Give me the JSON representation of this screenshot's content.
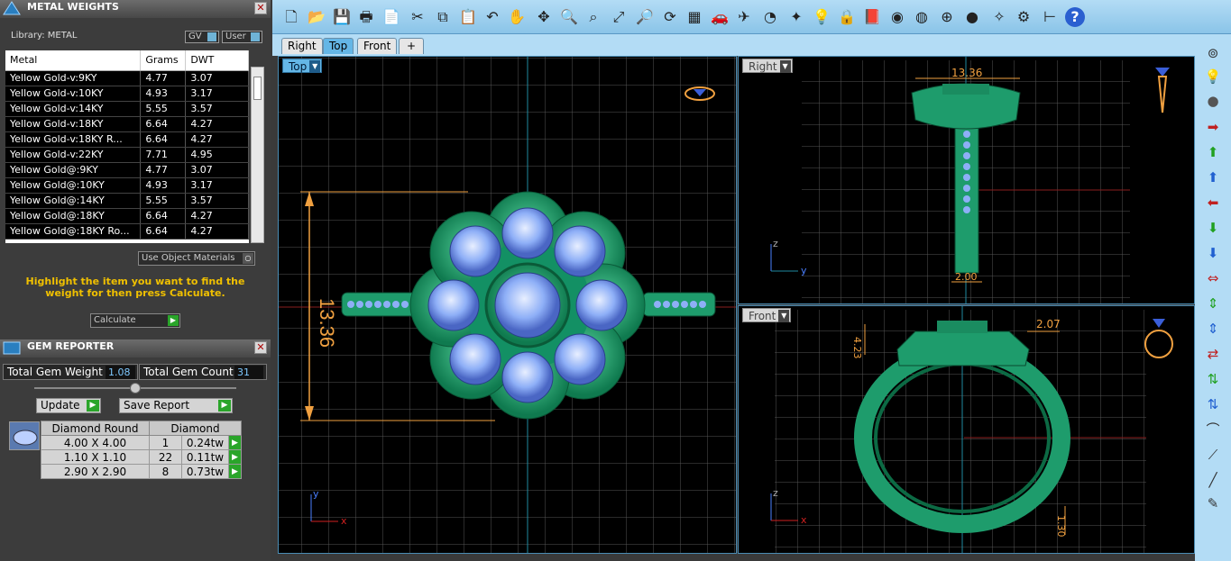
{
  "metal_weights": {
    "title": "METAL WEIGHTS",
    "library_label": "Library: METAL",
    "gv_label": "GV",
    "user_label": "User",
    "columns": [
      "Metal",
      "Grams",
      "DWT"
    ],
    "rows": [
      [
        "Yellow Gold-v:9KY",
        "4.77",
        "3.07"
      ],
      [
        "Yellow Gold-v:10KY",
        "4.93",
        "3.17"
      ],
      [
        "Yellow Gold-v:14KY",
        "5.55",
        "3.57"
      ],
      [
        "Yellow Gold-v:18KY",
        "6.64",
        "4.27"
      ],
      [
        "Yellow Gold-v:18KY R...",
        "6.64",
        "4.27"
      ],
      [
        "Yellow Gold-v:22KY",
        "7.71",
        "4.95"
      ],
      [
        "Yellow Gold@:9KY",
        "4.77",
        "3.07"
      ],
      [
        "Yellow Gold@:10KY",
        "4.93",
        "3.17"
      ],
      [
        "Yellow Gold@:14KY",
        "5.55",
        "3.57"
      ],
      [
        "Yellow Gold@:18KY",
        "6.64",
        "4.27"
      ],
      [
        "Yellow Gold@:18KY Ro...",
        "6.64",
        "4.27"
      ]
    ],
    "use_object_materials": "Use Object Materials",
    "hint": "Highlight the item you want to find the weight for then press Calculate.",
    "calculate_label": "Calculate"
  },
  "gem_reporter": {
    "title": "GEM REPORTER",
    "total_weight_label": "Total Gem Weight",
    "total_weight": "1.08",
    "total_count_label": "Total Gem Count",
    "total_count": "31",
    "update_label": "Update",
    "save_report_label": "Save Report",
    "columns": [
      "Diamond Round",
      "Diamond"
    ],
    "rows": [
      [
        "4.00 X 4.00",
        "1",
        "0.24tw"
      ],
      [
        "1.10 X 1.10",
        "22",
        "0.11tw"
      ],
      [
        "2.90 X 2.90",
        "8",
        "0.73tw"
      ]
    ]
  },
  "tabs": [
    "Right",
    "Top",
    "Front"
  ],
  "active_tab": "Top",
  "viewports": {
    "top": {
      "label": "Top",
      "dimension": "13.36",
      "axis_y": "y",
      "axis_x": "x"
    },
    "right": {
      "label": "Right",
      "dim_top": "13.36",
      "dim_bottom": "2.00",
      "axis_z": "z",
      "axis_y": "y"
    },
    "front": {
      "label": "Front",
      "dim_a": "4.23",
      "dim_b": "2.07",
      "dim_c": "1.30",
      "axis_z": "z",
      "axis_x": "x"
    }
  },
  "colors": {
    "toolbar": "#a3d3f0",
    "ring_green": "#1fa774",
    "gem_blue": "#7fa6f5",
    "dimension_orange": "#f0a040",
    "active_tab": "#64b6e6"
  }
}
